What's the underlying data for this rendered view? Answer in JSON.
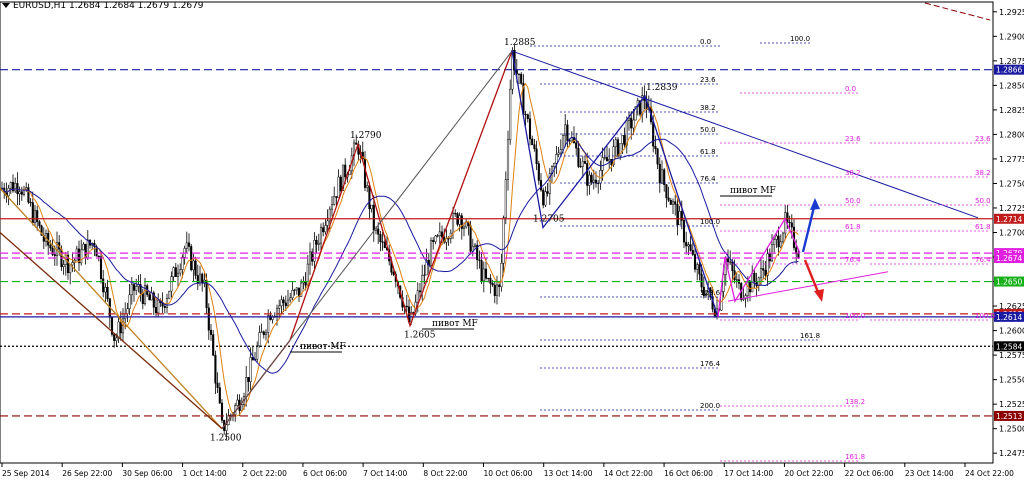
{
  "header": {
    "symbol_line": "EURUSD,H1  1.2684 1.2684 1.2679 1.2679"
  },
  "chart_data": {
    "type": "candlestick",
    "symbol": "EURUSD",
    "timeframe": "H1",
    "ohlc_header": {
      "open": 1.2684,
      "high": 1.2684,
      "low": 1.2679,
      "close": 1.2679
    },
    "ylim": [
      1.2465,
      1.2935
    ],
    "y_ticks": [
      "1.2925",
      "1.2900",
      "1.2875",
      "1.2850",
      "1.2825",
      "1.2800",
      "1.2775",
      "1.2750",
      "1.2725",
      "1.2700",
      "1.2675",
      "1.2650",
      "1.2625",
      "1.2600",
      "1.2575",
      "1.2550",
      "1.2525",
      "1.2500",
      "1.2475"
    ],
    "x_ticks": [
      "25 Sep 2014",
      "26 Sep 22:00",
      "30 Sep 06:00",
      "1 Oct 14:00",
      "2 Oct 22:00",
      "6 Oct 06:00",
      "7 Oct 14:00",
      "8 Oct 22:00",
      "10 Oct 06:00",
      "13 Oct 14:00",
      "14 Oct 22:00",
      "16 Oct 06:00",
      "17 Oct 14:00",
      "20 Oct 22:00",
      "22 Oct 06:00",
      "23 Oct 14:00",
      "24 Oct 22:00"
    ],
    "approx_close_path": [
      {
        "t": 0,
        "p": 1.2745
      },
      {
        "t": 20,
        "p": 1.275
      },
      {
        "t": 45,
        "p": 1.269
      },
      {
        "t": 70,
        "p": 1.2668
      },
      {
        "t": 95,
        "p": 1.2692
      },
      {
        "t": 115,
        "p": 1.259
      },
      {
        "t": 135,
        "p": 1.2645
      },
      {
        "t": 160,
        "p": 1.262
      },
      {
        "t": 185,
        "p": 1.2685
      },
      {
        "t": 205,
        "p": 1.264
      },
      {
        "t": 222,
        "p": 1.25
      },
      {
        "t": 240,
        "p": 1.253
      },
      {
        "t": 270,
        "p": 1.262
      },
      {
        "t": 300,
        "p": 1.264
      },
      {
        "t": 330,
        "p": 1.273
      },
      {
        "t": 358,
        "p": 1.279
      },
      {
        "t": 375,
        "p": 1.27
      },
      {
        "t": 395,
        "p": 1.266
      },
      {
        "t": 410,
        "p": 1.2605
      },
      {
        "t": 430,
        "p": 1.268
      },
      {
        "t": 460,
        "p": 1.272
      },
      {
        "t": 485,
        "p": 1.265
      },
      {
        "t": 500,
        "p": 1.264
      },
      {
        "t": 512,
        "p": 1.2885
      },
      {
        "t": 530,
        "p": 1.28
      },
      {
        "t": 545,
        "p": 1.273
      },
      {
        "t": 565,
        "p": 1.281
      },
      {
        "t": 590,
        "p": 1.275
      },
      {
        "t": 620,
        "p": 1.279
      },
      {
        "t": 645,
        "p": 1.2839
      },
      {
        "t": 660,
        "p": 1.276
      },
      {
        "t": 680,
        "p": 1.271
      },
      {
        "t": 700,
        "p": 1.265
      },
      {
        "t": 718,
        "p": 1.262
      },
      {
        "t": 725,
        "p": 1.2675
      },
      {
        "t": 740,
        "p": 1.264
      },
      {
        "t": 760,
        "p": 1.2655
      },
      {
        "t": 785,
        "p": 1.271
      },
      {
        "t": 800,
        "p": 1.2679
      }
    ],
    "price_labels": [
      {
        "label": "1.2885",
        "price": 1.2885
      },
      {
        "label": "1.2839",
        "price": 1.2839
      },
      {
        "label": "1.2790",
        "price": 1.279
      },
      {
        "label": "1.2705",
        "price": 1.2705
      },
      {
        "label": "1.2605",
        "price": 1.2605
      },
      {
        "label": "1.2500",
        "price": 1.25
      }
    ],
    "horizontal_levels": [
      {
        "label": "1.2866",
        "price": 1.2866,
        "color": "#1a1aa0",
        "style": "dashed"
      },
      {
        "label": "1.2714",
        "price": 1.2714,
        "color": "#c01c1c",
        "style": "solid"
      },
      {
        "label": "1.2679",
        "price": 1.2679,
        "color": "#e020e0",
        "style": "dashed"
      },
      {
        "label": "1.2674",
        "price": 1.2674,
        "color": "#e020e0",
        "style": "dashed"
      },
      {
        "label": "1.2650",
        "price": 1.265,
        "color": "#18b018",
        "style": "dashed"
      },
      {
        "label": "1.2617",
        "price": 1.2617,
        "color": "#c01c1c",
        "style": "dashed"
      },
      {
        "label": "1.2614",
        "price": 1.2614,
        "color": "#1a1aa0",
        "style": "solid"
      },
      {
        "label": "1.2584",
        "price": 1.2584,
        "color": "#000000",
        "style": "dotted"
      },
      {
        "label": "1.2513",
        "price": 1.2513,
        "color": "#8b0000",
        "style": "dashed"
      }
    ],
    "fib_levels_blue": [
      "0.0",
      "100.0",
      "23.6",
      "38.2",
      "50.0",
      "61.8",
      "76.4",
      "100.0",
      "123.6",
      "161.8",
      "176.4",
      "200.0"
    ],
    "fib_levels_pink": [
      "0.0",
      "23.6",
      "38.2",
      "50.0",
      "61.8",
      "76.4",
      "100.0",
      "138.2",
      "161.8",
      "23.6",
      "38.2",
      "50.0",
      "61.8",
      "76.4",
      "100.0"
    ],
    "annotations": [
      "пивот MF",
      "пивот MF",
      "пивот MF"
    ],
    "colors": {
      "candle": "#000000",
      "ma_fast": "#e08010",
      "ma_slow": "#1a1aa0",
      "zigzag_red": "#b01010",
      "zigzag_blue": "#1a1aa0",
      "zigzag_pink": "#e020e0",
      "arrow_up": "#1a3ad0",
      "arrow_down": "#e02020"
    }
  }
}
